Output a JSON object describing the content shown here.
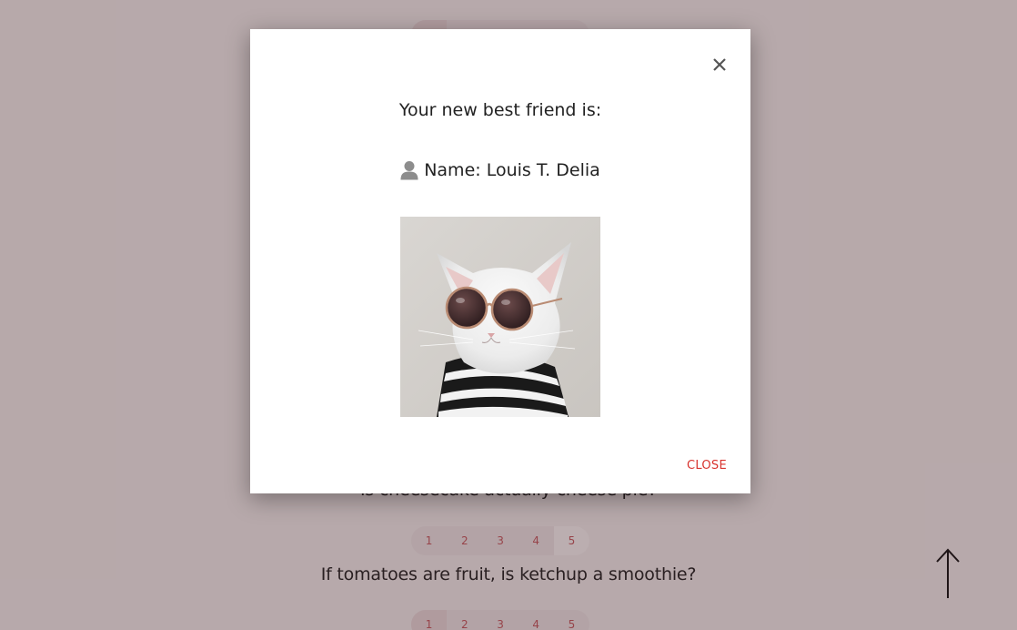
{
  "questions": [
    {
      "text": "",
      "selected": 1
    },
    {
      "text": "Is cheesecake actually cheese pie?",
      "selected": 5
    },
    {
      "text": "If tomatoes are fruit, is ketchup a smoothie?",
      "selected": 1
    }
  ],
  "rating_options": [
    "1",
    "2",
    "3",
    "4",
    "5"
  ],
  "modal": {
    "heading": "Your new best friend is:",
    "name_text": "Name: Louis T. Delia",
    "close_label": "CLOSE",
    "close_x": "×"
  },
  "icons": {
    "close": "close-icon",
    "user": "user-icon",
    "scroll_top": "arrow-up-icon"
  },
  "colors": {
    "accent": "#d8322d",
    "rating_text": "#c4575d",
    "overlay": "rgba(60,30,35,0.33)"
  }
}
